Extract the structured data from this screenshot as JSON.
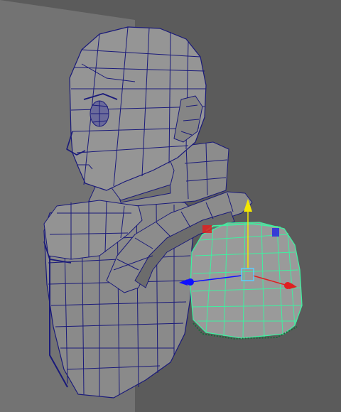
{
  "viewport": {
    "background": "#5b5b5b",
    "backdrop_plane": "#737373",
    "mesh_fill": "#8a8a8a",
    "mesh_shadow": "#6f6f6f",
    "wire_color": "#1a1a7a",
    "selection_wire": "#3ff0a0",
    "selected_fill": "#9a9a9a"
  },
  "manipulator": {
    "tool": "move-tool",
    "axis_colors": {
      "x": "#e02020",
      "y": "#f5e800",
      "z": "#1010ff",
      "center": "#5ad0ff"
    }
  },
  "selection": {
    "object": "shoulder-pad",
    "selected": true
  }
}
